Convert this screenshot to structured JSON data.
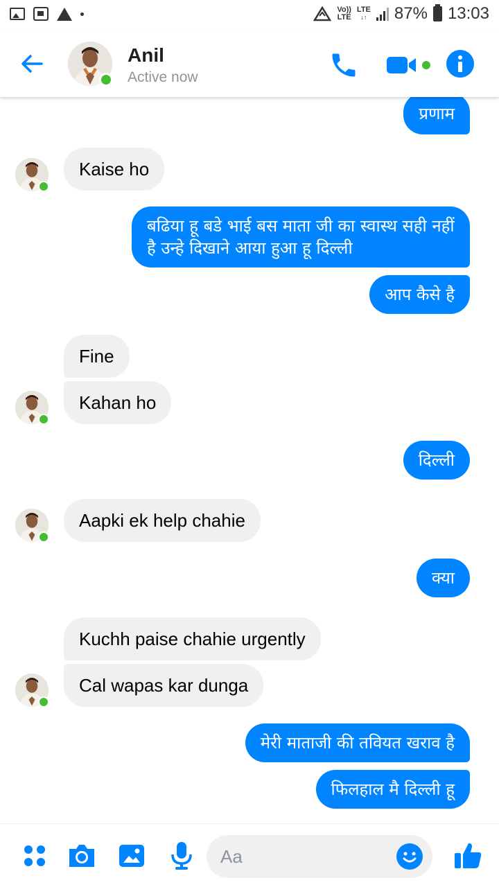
{
  "status_bar": {
    "network_label_top": "Vo))",
    "network_label_bottom": "LTE",
    "lte_label": "LTE",
    "battery": "87%",
    "time": "13:03"
  },
  "header": {
    "name": "Anil",
    "status": "Active now",
    "accent": "#0084ff",
    "online_color": "#44bd32"
  },
  "messages": [
    {
      "side": "out",
      "text": "प्रणाम"
    },
    {
      "side": "in",
      "text": "Kaise ho"
    },
    {
      "side": "out",
      "text": "बढिया हू बडे भाई बस माता जी का स्वास्थ सही नहीं है उन्हे दिखाने आया हुआ हू दिल्ली"
    },
    {
      "side": "out",
      "text": "आप कैसे है"
    },
    {
      "side": "in",
      "text": "Fine"
    },
    {
      "side": "in",
      "text": "Kahan ho"
    },
    {
      "side": "out",
      "text": "दिल्ली"
    },
    {
      "side": "in",
      "text": "Aapki ek help chahie"
    },
    {
      "side": "out",
      "text": "क्या"
    },
    {
      "side": "in",
      "text": "Kuchh paise chahie urgently"
    },
    {
      "side": "in",
      "text": "Cal wapas kar dunga"
    },
    {
      "side": "out",
      "text": "मेरी माताजी की तवियत खराव है"
    },
    {
      "side": "out",
      "text": "फिलहाल मै दिल्ली हू"
    }
  ],
  "composer": {
    "placeholder": "Aa",
    "icons": [
      "apps-icon",
      "camera-icon",
      "gallery-icon",
      "microphone-icon",
      "emoji-icon",
      "thumbs-up-icon"
    ]
  }
}
